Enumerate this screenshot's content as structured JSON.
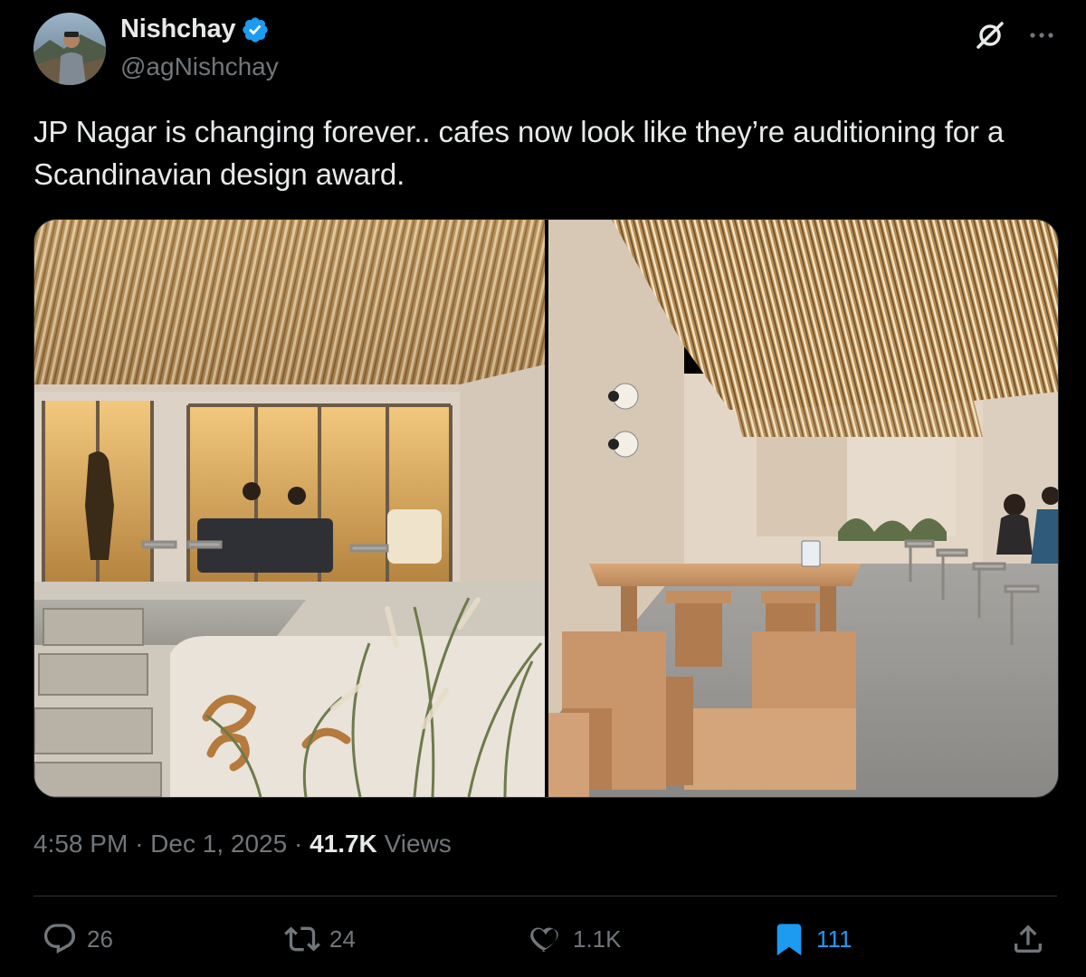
{
  "author": {
    "display_name": "Nishchay",
    "handle": "@agNishchay",
    "verified": true,
    "verified_color": "#1d9bf0"
  },
  "header_icons": [
    "grok-icon",
    "more-icon"
  ],
  "tweet": {
    "text": "JP Nagar is changing forever.. cafes now look like they’re auditioning for a Scandinavian design award."
  },
  "media": [
    {
      "subject": "cafe-exterior-glass-front"
    },
    {
      "subject": "cafe-courtyard-wooden-seating"
    }
  ],
  "meta": {
    "time": "4:58 PM",
    "separator": "·",
    "date": "Dec 1, 2025",
    "views_count": "41.7K",
    "views_label": "Views"
  },
  "actions": {
    "replies": {
      "icon": "reply-icon",
      "count": "26"
    },
    "reposts": {
      "icon": "repost-icon",
      "count": "24"
    },
    "likes": {
      "icon": "heart-icon",
      "count": "1.1K"
    },
    "bookmarks": {
      "icon": "bookmark-icon",
      "count": "111",
      "active": true,
      "active_color": "#1d9bf0"
    },
    "share": {
      "icon": "share-icon"
    }
  },
  "colors": {
    "background": "#000000",
    "text_primary": "#e7e9ea",
    "text_secondary": "#71767b",
    "accent": "#1d9bf0",
    "border": "#2f3336"
  }
}
